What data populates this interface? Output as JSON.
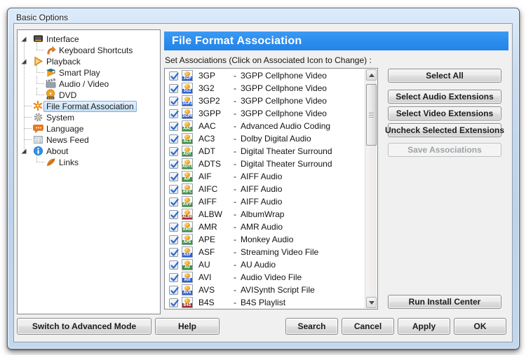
{
  "colors": {
    "header_blue": "#2a8cee",
    "band_video": "#2b5fd9",
    "band_audio": "#3f9440",
    "band_playlist": "#9c2f2f",
    "check_blue": "#3565c0",
    "selection_border": "#84acdd"
  },
  "window": {
    "title": "Basic Options"
  },
  "tree": {
    "items": [
      {
        "label": "Interface",
        "icon": "monitor-icon",
        "level": 0,
        "expanded": true,
        "selected": false
      },
      {
        "label": "Keyboard Shortcuts",
        "icon": "shortcut-arrow-icon",
        "level": 1,
        "expanded": false,
        "selected": false
      },
      {
        "label": "Playback",
        "icon": "play-icon",
        "level": 0,
        "expanded": true,
        "selected": false
      },
      {
        "label": "Smart Play",
        "icon": "smart-play-icon",
        "level": 1,
        "expanded": false,
        "selected": false
      },
      {
        "label": "Audio / Video",
        "icon": "clapperboard-icon",
        "level": 1,
        "expanded": false,
        "selected": false
      },
      {
        "label": "DVD",
        "icon": "dvd-disc-icon",
        "level": 1,
        "expanded": false,
        "selected": false
      },
      {
        "label": "File Format Association",
        "icon": "file-association-icon",
        "level": 0,
        "expanded": false,
        "selected": true
      },
      {
        "label": "System",
        "icon": "gear-icon",
        "level": 0,
        "expanded": false,
        "selected": false
      },
      {
        "label": "Language",
        "icon": "speech-bubble-icon",
        "level": 0,
        "expanded": false,
        "selected": false
      },
      {
        "label": "News Feed",
        "icon": "newspaper-icon",
        "level": 0,
        "expanded": false,
        "selected": false
      },
      {
        "label": "About",
        "icon": "info-icon",
        "level": 0,
        "expanded": true,
        "selected": false
      },
      {
        "label": "Links",
        "icon": "link-icon",
        "level": 1,
        "expanded": false,
        "selected": false
      }
    ]
  },
  "main": {
    "header": "File Format Association",
    "instruction": "Set Associations (Click on Associated Icon to Change) :",
    "separator": "-",
    "associations": [
      {
        "ext": "3GP",
        "desc": "3GPP Cellphone Video",
        "type": "video",
        "checked": true
      },
      {
        "ext": "3G2",
        "desc": "3GPP Cellphone Video",
        "type": "video",
        "checked": true
      },
      {
        "ext": "3GP2",
        "desc": "3GPP Cellphone Video",
        "type": "video",
        "checked": true
      },
      {
        "ext": "3GPP",
        "desc": "3GPP Cellphone Video",
        "type": "video",
        "checked": true
      },
      {
        "ext": "AAC",
        "desc": "Advanced Audio Coding",
        "type": "audio",
        "checked": true
      },
      {
        "ext": "AC3",
        "desc": "Dolby Digital Audio",
        "type": "audio",
        "checked": true
      },
      {
        "ext": "ADT",
        "desc": "Digital Theater Surround",
        "type": "audio",
        "checked": true
      },
      {
        "ext": "ADTS",
        "desc": "Digital Theater Surround",
        "type": "audio",
        "checked": true
      },
      {
        "ext": "AIF",
        "desc": "AIFF Audio",
        "type": "audio",
        "checked": true
      },
      {
        "ext": "AIFC",
        "desc": "AIFF Audio",
        "type": "audio",
        "checked": true
      },
      {
        "ext": "AIFF",
        "desc": "AIFF Audio",
        "type": "audio",
        "checked": true
      },
      {
        "ext": "ALBW",
        "desc": "AlbumWrap",
        "type": "playlist",
        "checked": true
      },
      {
        "ext": "AMR",
        "desc": "AMR Audio",
        "type": "audio",
        "checked": true
      },
      {
        "ext": "APE",
        "desc": "Monkey Audio",
        "type": "audio",
        "checked": true
      },
      {
        "ext": "ASF",
        "desc": "Streaming Video File",
        "type": "video",
        "checked": true
      },
      {
        "ext": "AU",
        "desc": "AU Audio",
        "type": "audio",
        "checked": true
      },
      {
        "ext": "AVI",
        "desc": "Audio Video File",
        "type": "video",
        "checked": true
      },
      {
        "ext": "AVS",
        "desc": "AVISynth Script File",
        "type": "video",
        "checked": true
      },
      {
        "ext": "B4S",
        "desc": "B4S Playlist",
        "type": "playlist",
        "checked": true
      }
    ]
  },
  "actions": {
    "select_all": "Select All",
    "select_audio": "Select Audio Extensions",
    "select_video": "Select Video Extensions",
    "uncheck_selected": "Uncheck Selected Extensions",
    "save_associations": "Save Associations",
    "run_install_center": "Run Install Center"
  },
  "footer": {
    "switch_mode": "Switch to Advanced Mode",
    "help": "Help",
    "search": "Search",
    "cancel": "Cancel",
    "apply": "Apply",
    "ok": "OK"
  }
}
